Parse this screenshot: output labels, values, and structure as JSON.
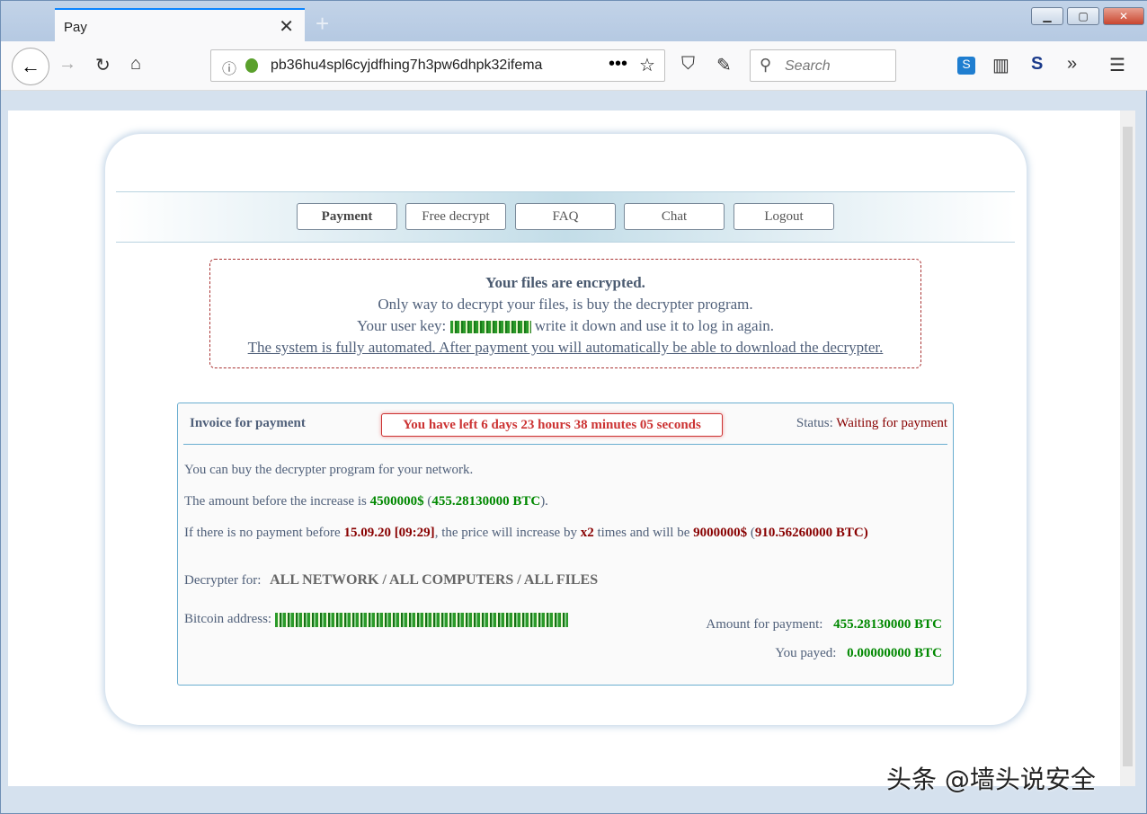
{
  "browser": {
    "tab_title": "Pay",
    "url": "pb36hu4spl6cyjdfhing7h3pw6dhpk32ifema",
    "search_placeholder": "Search"
  },
  "nav": [
    "Payment",
    "Free decrypt",
    "FAQ",
    "Chat",
    "Logout"
  ],
  "notice": {
    "title": "Your files are encrypted.",
    "line1": "Only way to decrypt your files, is buy the decrypter program.",
    "key_label": "Your user key:",
    "key_after": "write it down and use it to log in again.",
    "line3": "The system is fully automated. After payment you will automatically be able to download the decrypter."
  },
  "invoice": {
    "title": "Invoice for payment",
    "timer": "You have left 6 days 23 hours 38 minutes 05 seconds",
    "status_label": "Status:",
    "status": "Waiting for payment",
    "line1": "You can buy the decrypter program for your network.",
    "line2_pre": "The amount before the increase is",
    "amount_usd": "4500000$",
    "amount_btc": "455.28130000 BTC",
    "line3_pre": "If there is no payment before",
    "deadline": "15.09.20 [09:29]",
    "line3_mid": ", the price will increase by",
    "multiplier": "x2",
    "line3_mid2": "times and will be",
    "new_usd": "9000000$",
    "new_btc": "910.56260000 BTC)",
    "decrypter_label": "Decrypter for:",
    "decrypter_value": "ALL NETWORK / ALL COMPUTERS / ALL FILES",
    "bitcoin_label": "Bitcoin address:",
    "amount_label": "Amount for payment:",
    "amount_value": "455.28130000 BTC",
    "payed_label": "You payed:",
    "payed_value": "0.00000000 BTC"
  },
  "watermark": "头条 @墙头说安全",
  "colors": {
    "green": "#008800",
    "red": "#880000",
    "timer": "#cc3333"
  }
}
